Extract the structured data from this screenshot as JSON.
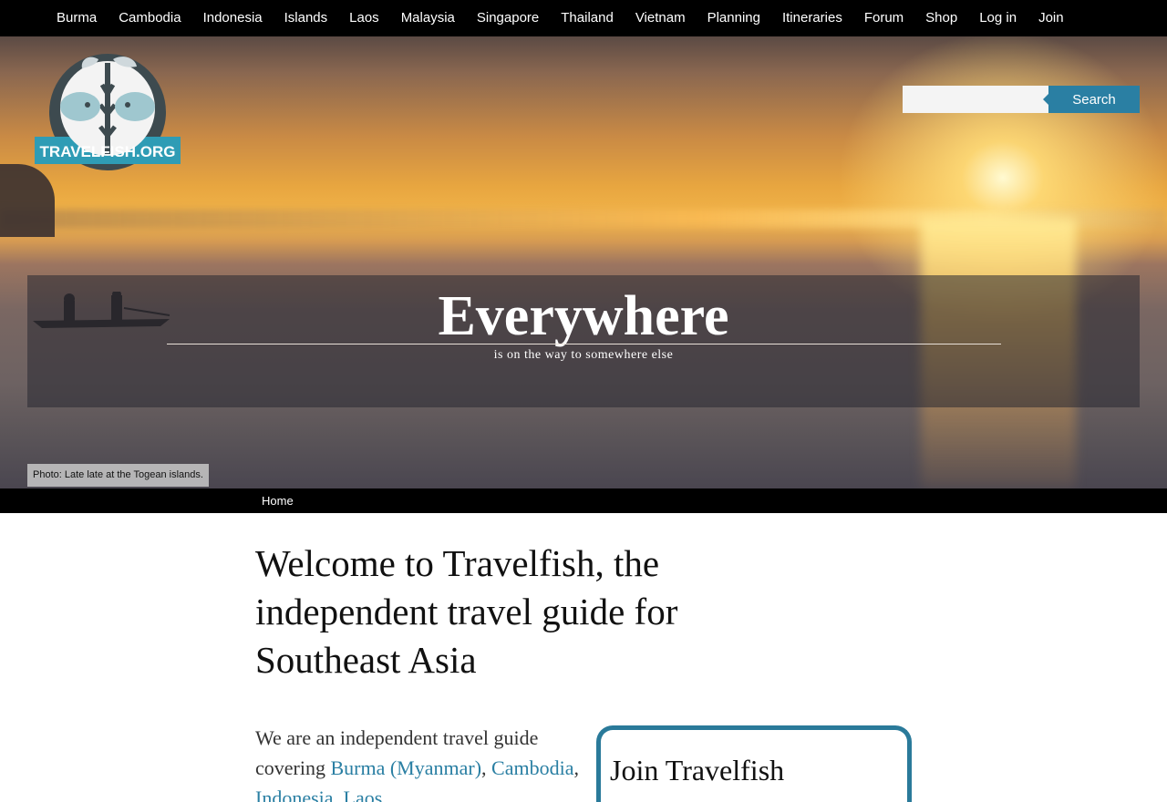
{
  "nav": {
    "items": [
      "Burma",
      "Cambodia",
      "Indonesia",
      "Islands",
      "Laos",
      "Malaysia",
      "Singapore",
      "Thailand",
      "Vietnam",
      "Planning",
      "Itineraries",
      "Forum",
      "Shop",
      "Log in",
      "Join"
    ]
  },
  "logo": {
    "text": "TRAVELFISH.ORG"
  },
  "search": {
    "button_label": "Search",
    "placeholder": ""
  },
  "hero": {
    "title": "Everywhere",
    "subtitle": "is on the way to somewhere else",
    "photo_credit": "Photo: Late late at the Togean islands."
  },
  "breadcrumb": {
    "home": "Home"
  },
  "main": {
    "title": "Welcome to Travelfish, the independent travel guide for Southeast Asia",
    "intro_prefix": "We are an independent travel guide covering ",
    "links": [
      "Burma (Myanmar)",
      "Cambodia",
      "Indonesia",
      "Laos"
    ],
    "sep1": ",",
    "sep2": ",",
    "sep3": ",",
    "sep4": ","
  },
  "sidebar": {
    "join_title": "Join Travelfish"
  },
  "colors": {
    "accent": "#2a7fa3",
    "nav_bg": "#000000"
  }
}
